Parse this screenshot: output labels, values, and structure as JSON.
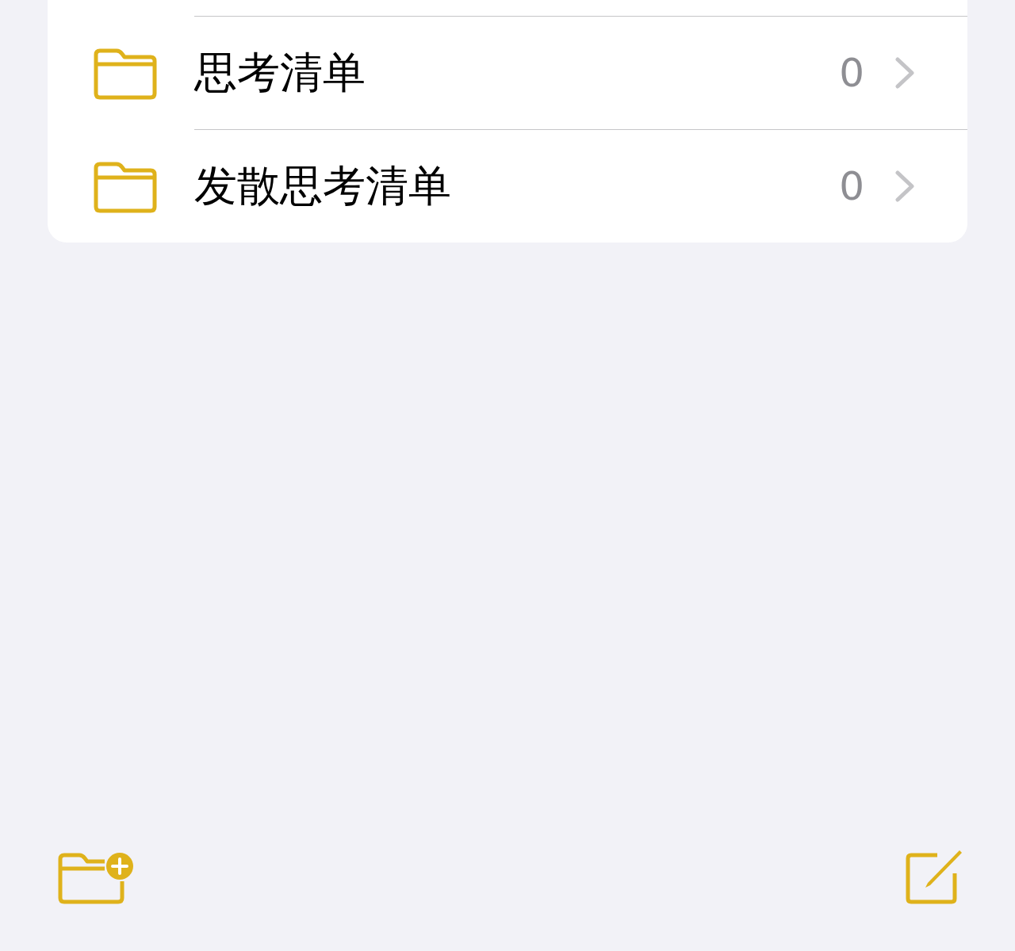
{
  "folders": [
    {
      "name": "思考清单",
      "count": "0"
    },
    {
      "name": "发散思考清单",
      "count": "0"
    }
  ]
}
